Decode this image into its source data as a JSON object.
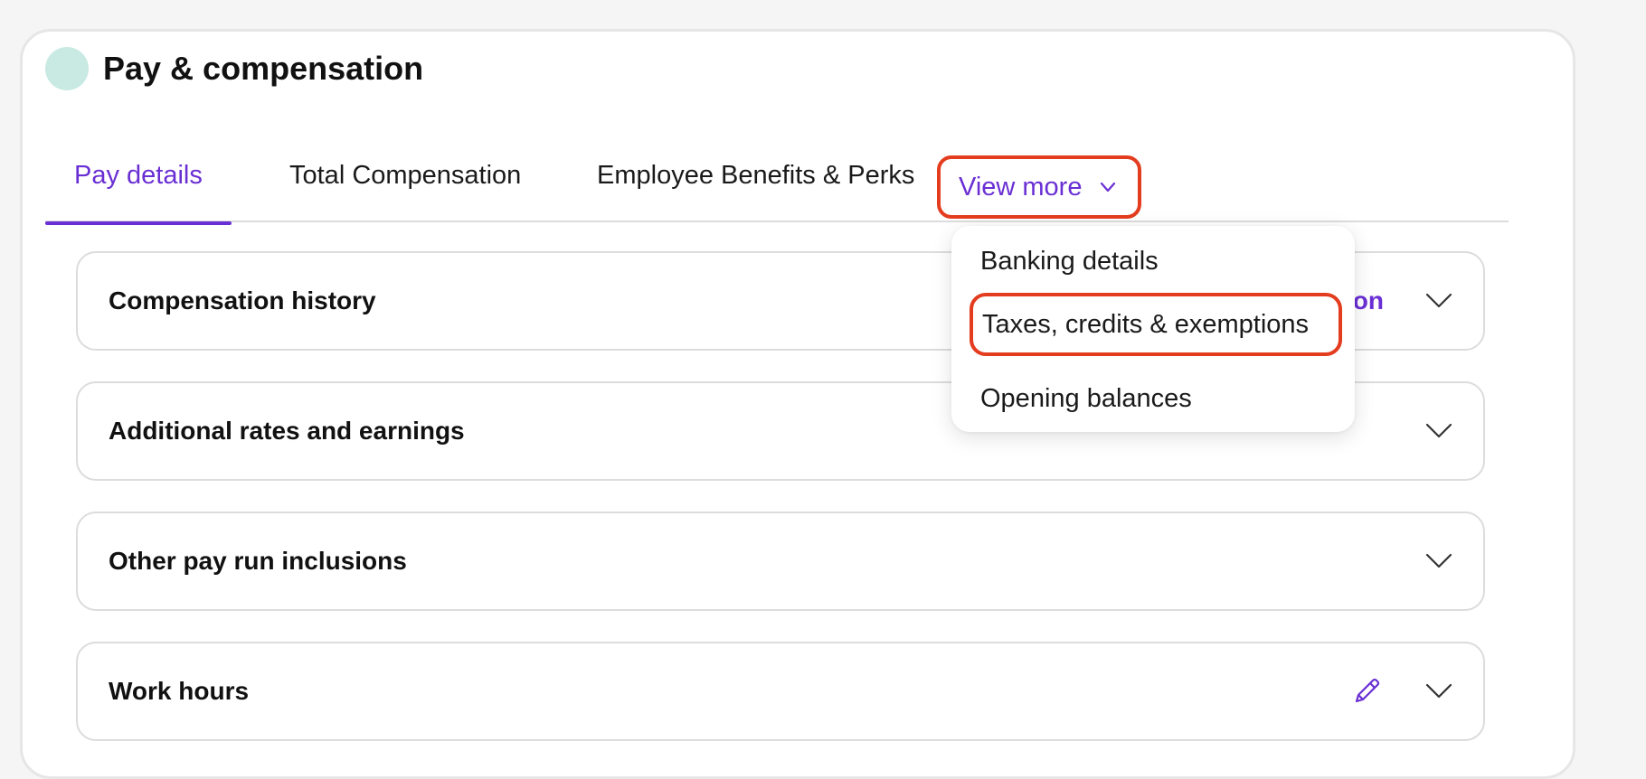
{
  "header": {
    "title": "Pay & compensation"
  },
  "tabs": [
    {
      "label": "Pay details"
    },
    {
      "label": "Total Compensation"
    },
    {
      "label": "Employee Benefits & Perks"
    }
  ],
  "view_more": {
    "label": "View more"
  },
  "dropdown": {
    "items": [
      {
        "label": "Banking details"
      },
      {
        "label": "Taxes, credits & exemptions"
      },
      {
        "label": "Opening balances"
      }
    ]
  },
  "sections": [
    {
      "title": "Compensation history",
      "action": "tion"
    },
    {
      "title": "Additional rates and earnings"
    },
    {
      "title": "Other pay run inclusions"
    },
    {
      "title": "Work hours"
    }
  ],
  "colors": {
    "accent": "#6a2fd4",
    "highlight": "#e43c1e",
    "avatar": "#c8eae2"
  }
}
